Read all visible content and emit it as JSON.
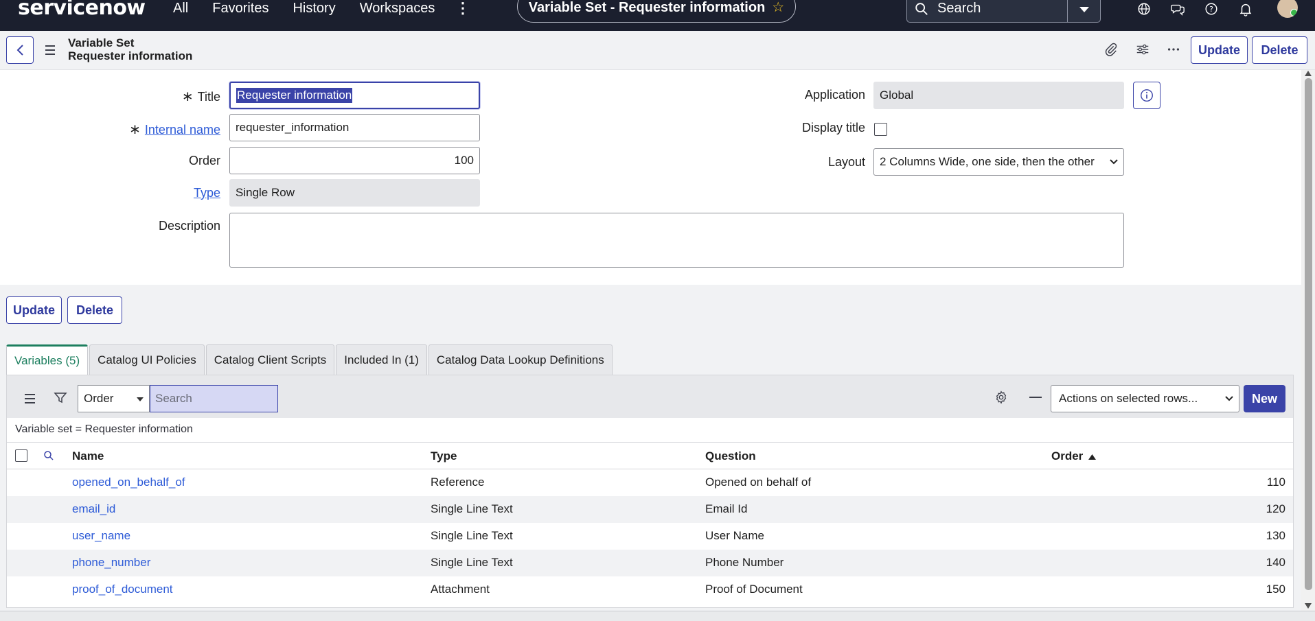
{
  "topnav": {
    "logo": "servicenow",
    "links": [
      "All",
      "Favorites",
      "History",
      "Workspaces"
    ],
    "more_icon": "vertical-dots-icon",
    "record_pill": "Variable Set - Requester information",
    "search_placeholder": "Search"
  },
  "header": {
    "line1": "Variable Set",
    "line2": "Requester information",
    "update_label": "Update",
    "delete_label": "Delete"
  },
  "form": {
    "title_label": "Title",
    "title_value": "Requester information",
    "internal_name_label": "Internal name",
    "internal_name_value": "requester_information",
    "order_label": "Order",
    "order_value": "100",
    "type_label": "Type",
    "type_value": "Single Row",
    "description_label": "Description",
    "description_value": "",
    "application_label": "Application",
    "application_value": "Global",
    "display_title_label": "Display title",
    "display_title_checked": false,
    "layout_label": "Layout",
    "layout_value": "2 Columns Wide, one side, then the other"
  },
  "form_buttons": {
    "update_label": "Update",
    "delete_label": "Delete"
  },
  "tabs": [
    {
      "label": "Variables (5)",
      "active": true
    },
    {
      "label": "Catalog UI Policies",
      "active": false
    },
    {
      "label": "Catalog Client Scripts",
      "active": false
    },
    {
      "label": "Included In (1)",
      "active": false
    },
    {
      "label": "Catalog Data Lookup Definitions",
      "active": false
    }
  ],
  "list": {
    "search_field": "Order",
    "search_placeholder": "Search",
    "actions_label": "Actions on selected rows...",
    "new_label": "New",
    "breadcrumb": "Variable set = Requester information",
    "columns": [
      "Name",
      "Type",
      "Question",
      "Order"
    ],
    "sort_column": "Order",
    "sort_direction": "ascending",
    "rows": [
      {
        "name": "opened_on_behalf_of",
        "type": "Reference",
        "question": "Opened on behalf of",
        "order": "110"
      },
      {
        "name": "email_id",
        "type": "Single Line Text",
        "question": "Email Id",
        "order": "120"
      },
      {
        "name": "user_name",
        "type": "Single Line Text",
        "question": "User Name",
        "order": "130"
      },
      {
        "name": "phone_number",
        "type": "Single Line Text",
        "question": "Phone Number",
        "order": "140"
      },
      {
        "name": "proof_of_document",
        "type": "Attachment",
        "question": "Proof of Document",
        "order": "150"
      }
    ]
  },
  "colors": {
    "nav_bg": "#1b1f2e",
    "primary": "#3a43a8",
    "link": "#2d5bd7",
    "active_tab": "#1d7f5f",
    "star": "#f3c624"
  }
}
